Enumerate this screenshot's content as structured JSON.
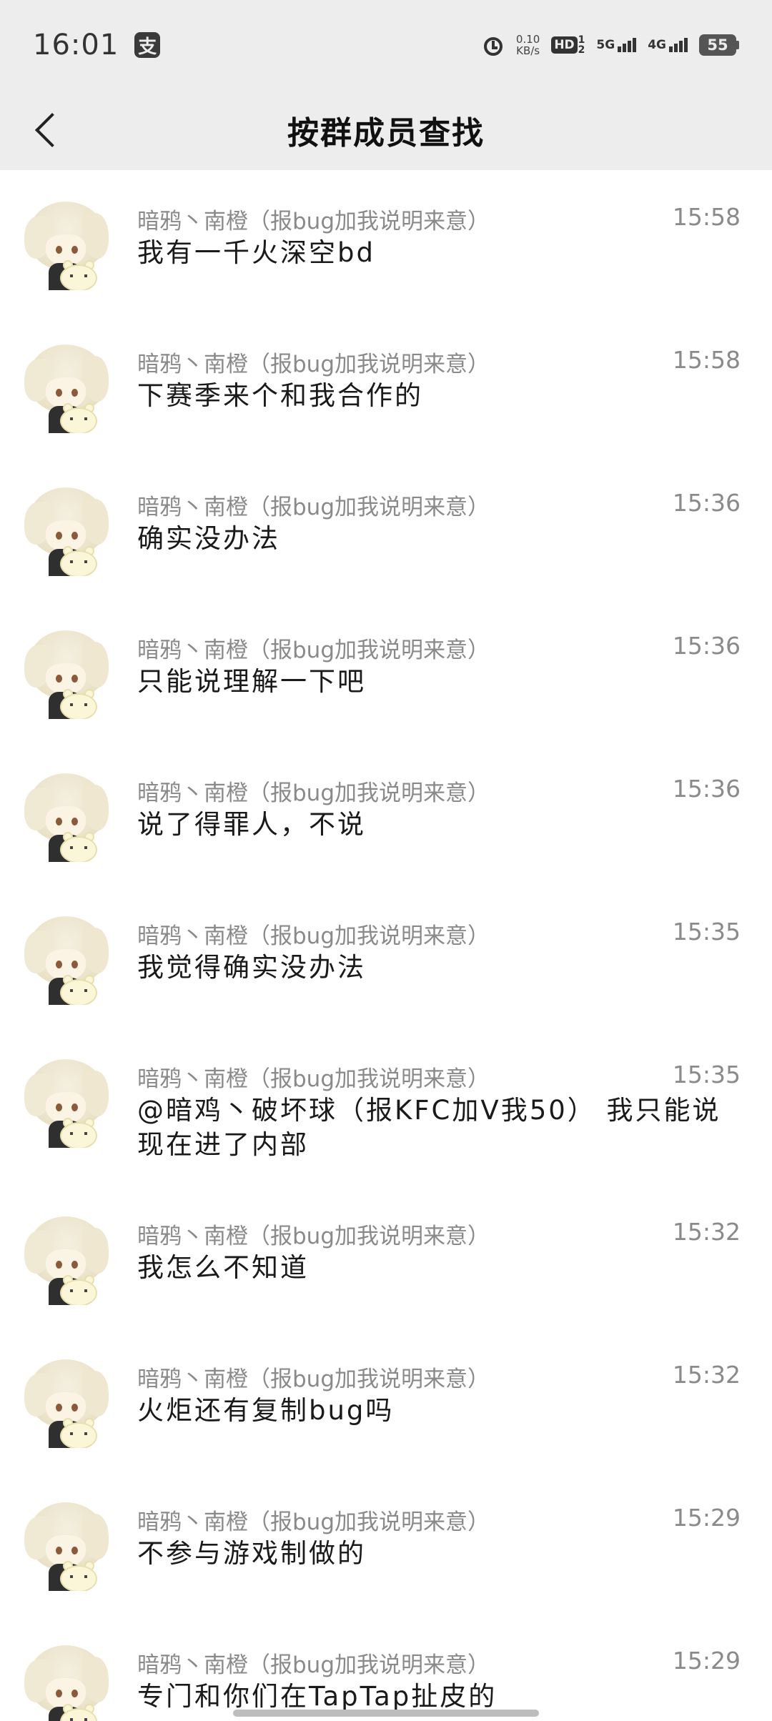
{
  "status_bar": {
    "time": "16:01",
    "app_icon": "支",
    "speed_value": "0.10",
    "speed_unit": "KB/s",
    "hd_label": "HD",
    "hd_sub_top": "1",
    "hd_sub_bottom": "2",
    "net1_label": "5G",
    "net2_label": "4G",
    "battery": "55"
  },
  "header": {
    "title": "按群成员查找"
  },
  "messages": [
    {
      "sender": "暗鸦丶南橙（报bug加我说明来意）",
      "time": "15:58",
      "text": "我有一千火深空bd"
    },
    {
      "sender": "暗鸦丶南橙（报bug加我说明来意）",
      "time": "15:58",
      "text": "下赛季来个和我合作的"
    },
    {
      "sender": "暗鸦丶南橙（报bug加我说明来意）",
      "time": "15:36",
      "text": "确实没办法"
    },
    {
      "sender": "暗鸦丶南橙（报bug加我说明来意）",
      "time": "15:36",
      "text": "只能说理解一下吧"
    },
    {
      "sender": "暗鸦丶南橙（报bug加我说明来意）",
      "time": "15:36",
      "text": "说了得罪人，不说"
    },
    {
      "sender": "暗鸦丶南橙（报bug加我说明来意）",
      "time": "15:35",
      "text": "我觉得确实没办法"
    },
    {
      "sender": "暗鸦丶南橙（报bug加我说明来意）",
      "time": "15:35",
      "text": "@暗鸡丶破坏球（报KFC加V我50） 我只能说现在进了内部"
    },
    {
      "sender": "暗鸦丶南橙（报bug加我说明来意）",
      "time": "15:32",
      "text": "我怎么不知道"
    },
    {
      "sender": "暗鸦丶南橙（报bug加我说明来意）",
      "time": "15:32",
      "text": "火炬还有复制bug吗"
    },
    {
      "sender": "暗鸦丶南橙（报bug加我说明来意）",
      "time": "15:29",
      "text": "不参与游戏制做的"
    },
    {
      "sender": "暗鸦丶南橙（报bug加我说明来意）",
      "time": "15:29",
      "text": "专门和你们在TapTap扯皮的"
    }
  ]
}
